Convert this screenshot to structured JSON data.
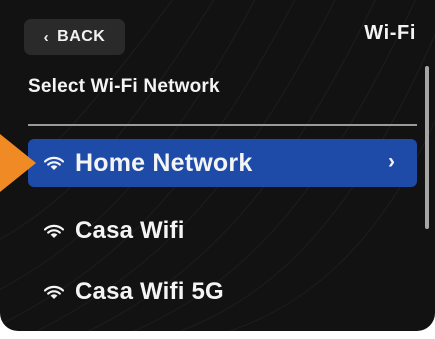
{
  "header": {
    "back_label": "BACK",
    "back_icon": "chevron-left-icon",
    "title": "Wi-Fi"
  },
  "section": {
    "heading": "Select Wi-Fi Network"
  },
  "networks": [
    {
      "name": "Home Network",
      "selected": true,
      "icon": "wifi-icon",
      "trailing_icon": "chevron-right-icon"
    },
    {
      "name": "Casa Wifi",
      "selected": false,
      "icon": "wifi-icon"
    },
    {
      "name": "Casa Wifi 5G",
      "selected": false,
      "icon": "wifi-icon"
    }
  ],
  "colors": {
    "screen_background": "#121212",
    "selection_highlight": "#1e4aa8",
    "text": "#f4f4f4",
    "pointer_accent": "#f08a24"
  }
}
